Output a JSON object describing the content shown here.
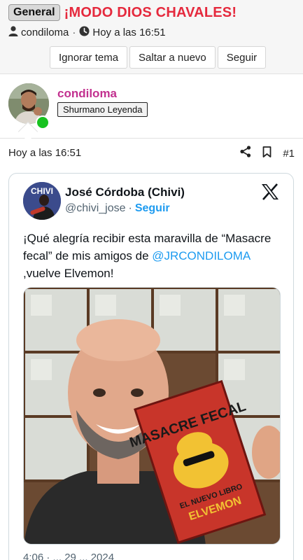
{
  "thread": {
    "category": "General",
    "title": "¡MODO DIOS CHAVALES!",
    "author": "condiloma",
    "time": "Hoy a las 16:51",
    "buttons": {
      "ignore": "Ignorar tema",
      "jump": "Saltar a nuevo",
      "follow": "Seguir"
    }
  },
  "post": {
    "author": "condiloma",
    "rank": "Shurmano Leyenda",
    "time": "Hoy a las 16:51",
    "number": "#1",
    "colors": {
      "author": "#c2308f",
      "online": "#17c21f",
      "title": "#e5293d"
    }
  },
  "tweet": {
    "name": "José Córdoba (Chivi)",
    "handle": "@chivi_jose",
    "separator": "·",
    "follow": "Seguir",
    "text_before": "¡Qué alegría recibir esta maravilla de “Masacre fecal” de mis amigos de ",
    "mention": "@JRCONDILOMA",
    "text_after": " ,vuelve Elvemon!",
    "date_partial": "4:06 · ... 29 ... 2024",
    "avatar_text": "CHIVI",
    "book_title": "MASACRE FECAL",
    "book_subtitle": "EL NUEVO LIBRO",
    "book_author": "ELVEMON",
    "colors": {
      "link": "#1d9bf0",
      "handle": "#536471"
    }
  }
}
